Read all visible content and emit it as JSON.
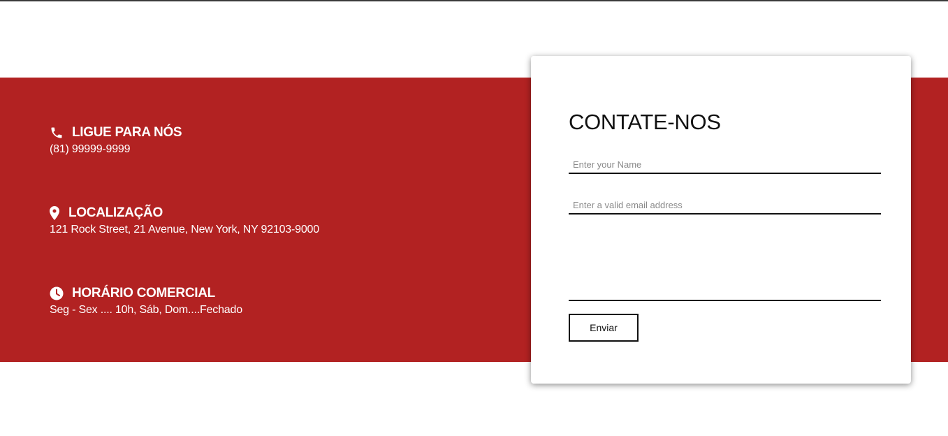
{
  "colors": {
    "band": "#b22222",
    "top_rule": "#3a3a3a",
    "card_bg": "#ffffff"
  },
  "info": [
    {
      "icon": "phone-icon",
      "title": "LIGUE PARA NÓS",
      "text": "(81) 99999-9999"
    },
    {
      "icon": "map-pin-icon",
      "title": "LOCALIZAÇÃO",
      "text": "121 Rock Street, 21 Avenue, New York, NY 92103-9000"
    },
    {
      "icon": "clock-icon",
      "title": "HORÁRIO COMERCIAL",
      "text": "Seg - Sex .... 10h, Sáb, Dom....Fechado"
    }
  ],
  "contact_form": {
    "title": "CONTATE-NOS",
    "name_placeholder": "Enter your Name",
    "name_value": "",
    "email_placeholder": "Enter a valid email address",
    "email_value": "",
    "message_value": "",
    "submit_label": "Enviar"
  }
}
